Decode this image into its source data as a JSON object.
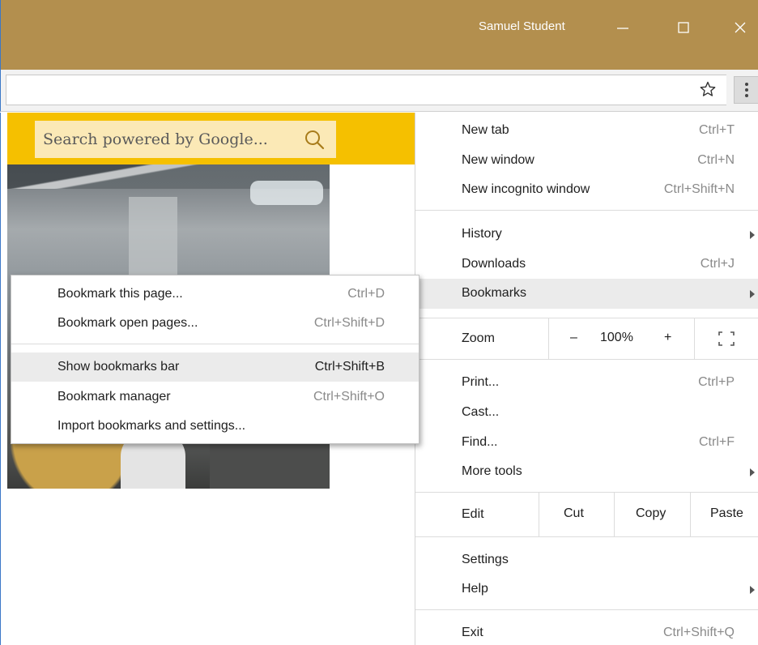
{
  "window": {
    "user_name": "Samuel Student",
    "minimize_icon": "minimize-icon",
    "maximize_icon": "maximize-icon",
    "close_icon": "close-icon"
  },
  "toolbar": {
    "bookmark_star_icon": "star-icon",
    "menu_icon": "three-dot-menu-icon"
  },
  "page": {
    "search_placeholder": "Search powered by Google...",
    "search_icon": "search-icon"
  },
  "main_menu": {
    "group1": [
      {
        "label": "New tab",
        "shortcut": "Ctrl+T"
      },
      {
        "label": "New window",
        "shortcut": "Ctrl+N"
      },
      {
        "label": "New incognito window",
        "shortcut": "Ctrl+Shift+N"
      }
    ],
    "group2": [
      {
        "label": "History",
        "shortcut": "",
        "submenu": true
      },
      {
        "label": "Downloads",
        "shortcut": "Ctrl+J"
      },
      {
        "label": "Bookmarks",
        "shortcut": "",
        "submenu": true,
        "highlighted": true
      }
    ],
    "zoom": {
      "label": "Zoom",
      "minus": "–",
      "value": "100%",
      "plus": "+",
      "fullscreen_icon": "fullscreen-icon"
    },
    "group3": [
      {
        "label": "Print...",
        "shortcut": "Ctrl+P"
      },
      {
        "label": "Cast...",
        "shortcut": ""
      },
      {
        "label": "Find...",
        "shortcut": "Ctrl+F"
      },
      {
        "label": "More tools",
        "shortcut": "",
        "submenu": true
      }
    ],
    "edit": {
      "label": "Edit",
      "cut": "Cut",
      "copy": "Copy",
      "paste": "Paste"
    },
    "group4": [
      {
        "label": "Settings",
        "shortcut": ""
      },
      {
        "label": "Help",
        "shortcut": "",
        "submenu": true
      }
    ],
    "exit": {
      "label": "Exit",
      "shortcut": "Ctrl+Shift+Q"
    }
  },
  "bookmarks_menu": {
    "items": [
      {
        "label": "Bookmark this page...",
        "shortcut": "Ctrl+D"
      },
      {
        "label": "Bookmark open pages...",
        "shortcut": "Ctrl+Shift+D"
      },
      {
        "label": "Show bookmarks bar",
        "shortcut": "Ctrl+Shift+B",
        "highlighted": true
      },
      {
        "label": "Bookmark manager",
        "shortcut": "Ctrl+Shift+O"
      },
      {
        "label": "Import bookmarks and settings...",
        "shortcut": ""
      }
    ]
  }
}
